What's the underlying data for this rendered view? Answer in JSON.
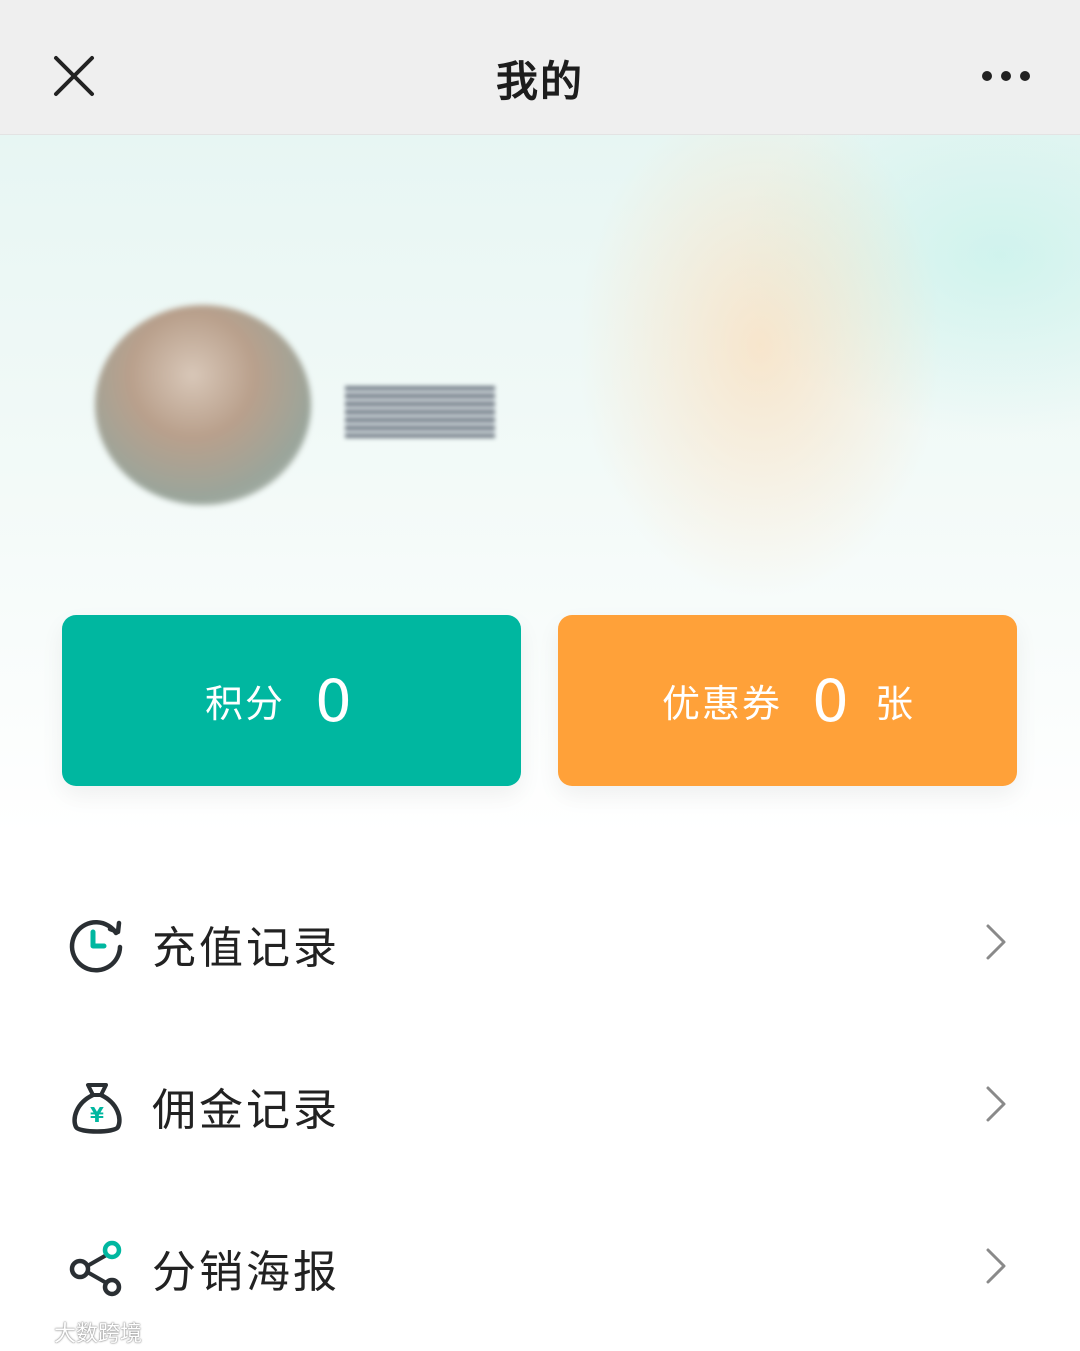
{
  "header": {
    "title": "我的"
  },
  "profile": {
    "username": ""
  },
  "cards": {
    "points": {
      "label": "积分",
      "value": "0"
    },
    "coupons": {
      "label": "优惠券",
      "value": "0",
      "unit": "张"
    }
  },
  "menu": [
    {
      "label": "充值记录",
      "icon": "clock-refresh-icon"
    },
    {
      "label": "佣金记录",
      "icon": "money-bag-yen-icon"
    },
    {
      "label": "分销海报",
      "icon": "share-icon"
    }
  ],
  "watermark": {
    "text": "大数跨境"
  },
  "colors": {
    "points_card": "#00b7a0",
    "coupons_card": "#ffa139",
    "accent": "#00b7a0"
  }
}
